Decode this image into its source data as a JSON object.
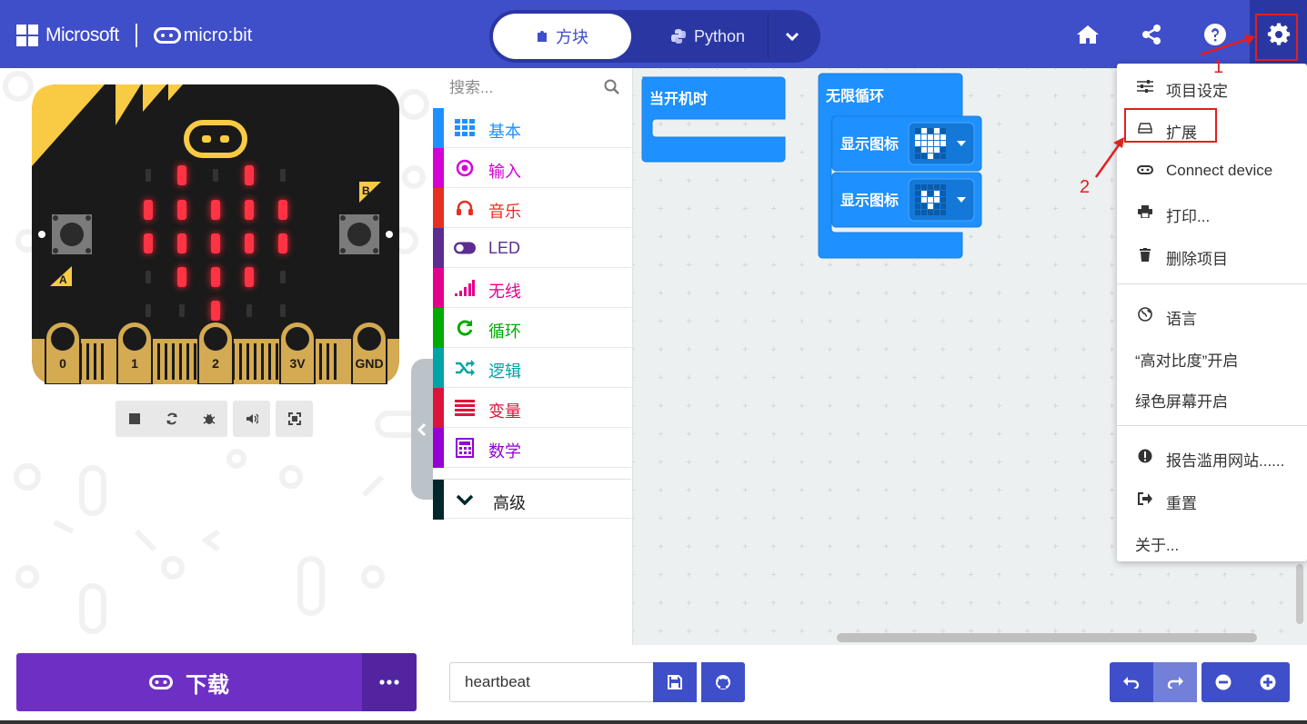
{
  "header": {
    "brand": "Microsoft",
    "product": "micro:bit",
    "mode_blocks": "方块",
    "mode_python": "Python"
  },
  "simulator": {
    "pins": [
      "0",
      "1",
      "2",
      "3V",
      "GND"
    ],
    "button_a": "A",
    "button_b": "B",
    "led_on": [
      [
        0,
        1,
        0,
        1,
        0
      ],
      [
        1,
        1,
        1,
        1,
        1
      ],
      [
        1,
        1,
        1,
        1,
        1
      ],
      [
        0,
        1,
        1,
        1,
        0
      ],
      [
        0,
        0,
        1,
        0,
        0
      ]
    ]
  },
  "toolbox": {
    "search_placeholder": "搜索...",
    "categories": [
      {
        "label": "基本",
        "color": "#1e90ff"
      },
      {
        "label": "输入",
        "color": "#d400d4"
      },
      {
        "label": "音乐",
        "color": "#e63022"
      },
      {
        "label": "LED",
        "color": "#5c2d91"
      },
      {
        "label": "无线",
        "color": "#e3008c"
      },
      {
        "label": "循环",
        "color": "#00aa00"
      },
      {
        "label": "逻辑",
        "color": "#00a4a6"
      },
      {
        "label": "变量",
        "color": "#dc143c"
      },
      {
        "label": "数学",
        "color": "#9400d3"
      }
    ],
    "advanced": "高级",
    "advanced_color": "#00272b"
  },
  "workspace": {
    "on_start_label": "当开机时",
    "forever_label": "无限循环",
    "show_icon_1": "显示图标",
    "show_icon_2": "显示图标",
    "block_color": "#1e90ff"
  },
  "settings_menu": {
    "items": [
      {
        "label": "项目设定",
        "icon": "sliders-icon"
      },
      {
        "label": "扩展",
        "icon": "drive-icon"
      },
      {
        "label": "Connect device",
        "icon": "microbit-icon"
      },
      {
        "label": "打印...",
        "icon": "print-icon"
      },
      {
        "label": "删除项目",
        "icon": "trash-icon"
      },
      {
        "label": "语言",
        "icon": "globe-icon"
      },
      {
        "label": "“高对比度”开启",
        "icon": ""
      },
      {
        "label": "绿色屏幕开启",
        "icon": ""
      },
      {
        "label": "报告滥用网站......",
        "icon": "alert-icon"
      },
      {
        "label": "重置",
        "icon": "signout-icon"
      },
      {
        "label": "关于...",
        "icon": ""
      }
    ]
  },
  "annotations": {
    "step1": "1",
    "step2": "2",
    "color": "#e02020"
  },
  "footer": {
    "download_label": "下载",
    "project_name": "heartbeat"
  },
  "colors": {
    "header": "#3f4ec9",
    "header_dark": "#2a37a3",
    "download": "#6e2fc4",
    "workspace_bg": "#ecf0f1"
  }
}
